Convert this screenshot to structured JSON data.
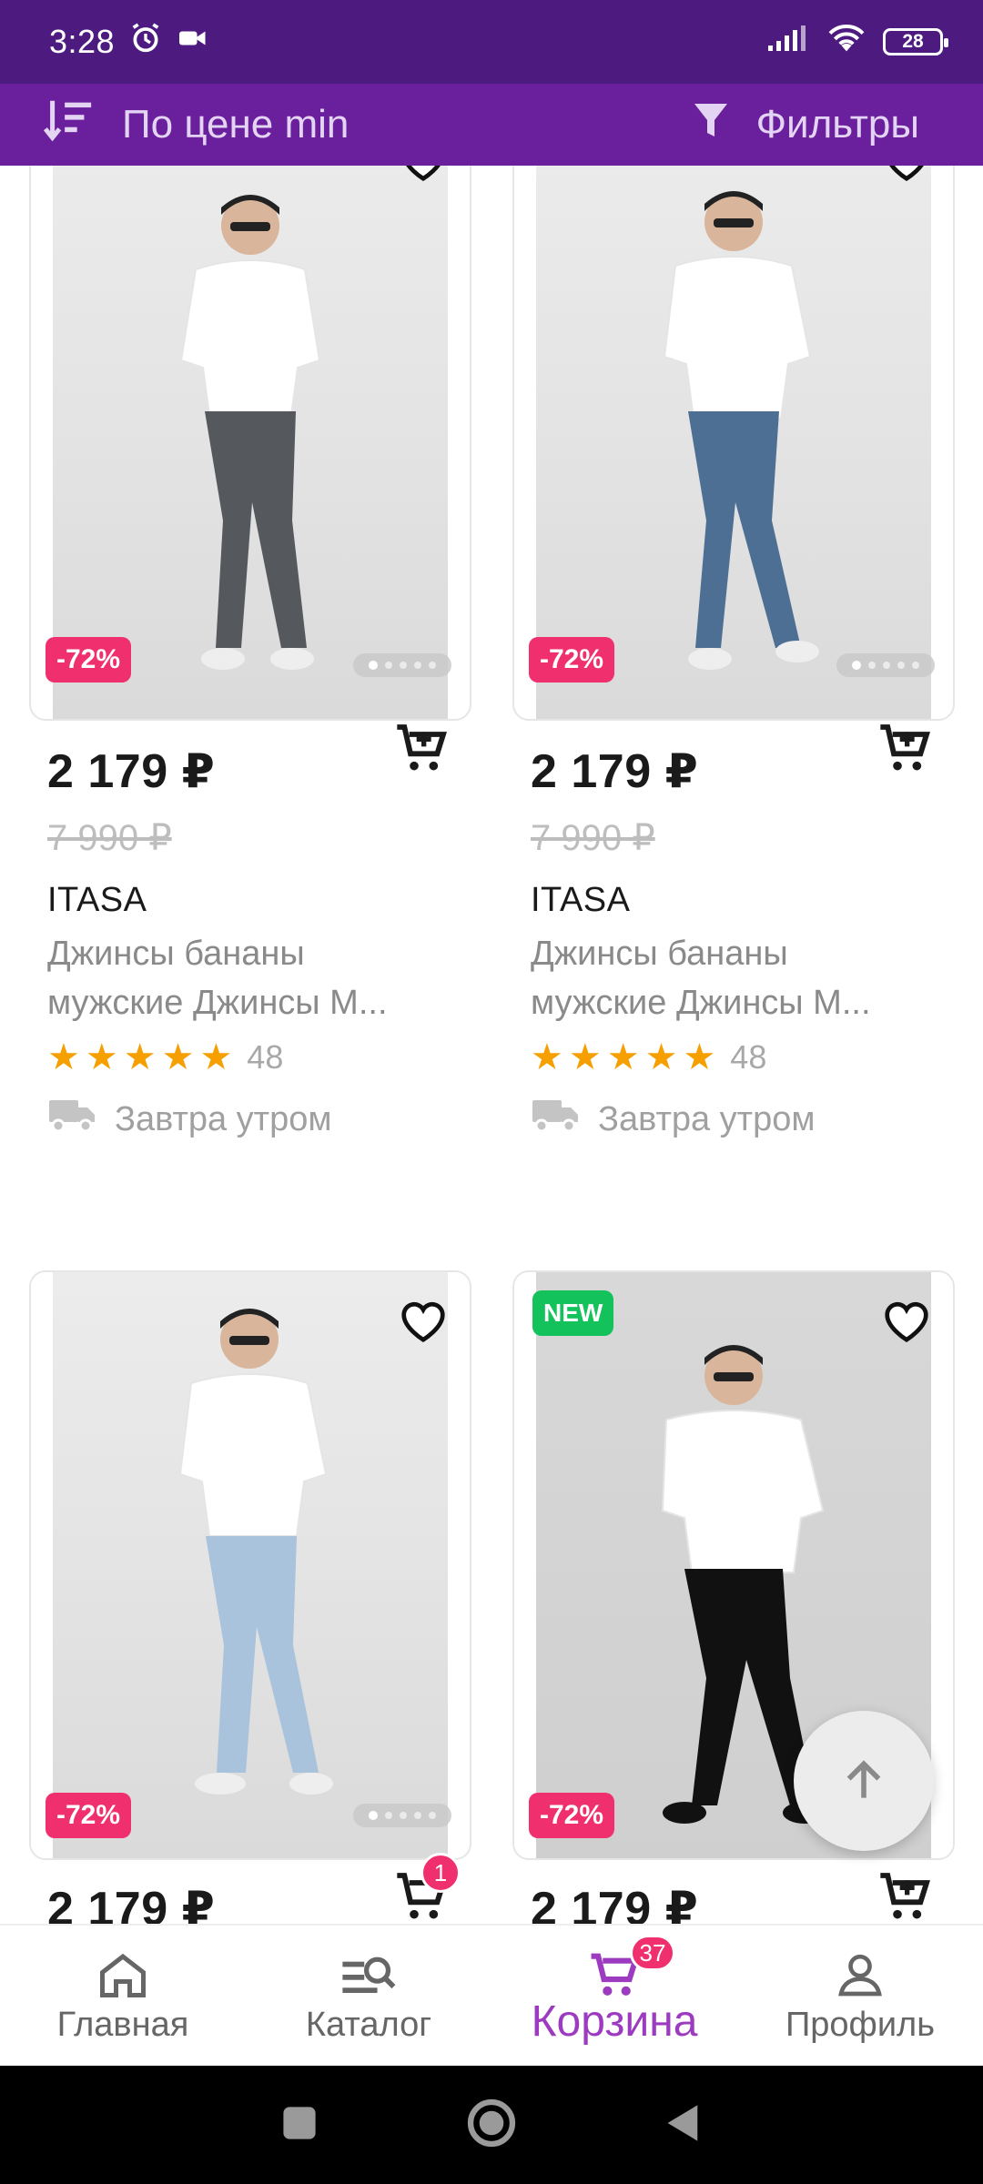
{
  "status_bar": {
    "time": "3:28",
    "battery": "28"
  },
  "toolbar": {
    "sort_label": "По цене min",
    "filter_label": "Фильтры"
  },
  "products": [
    {
      "price": "2 179 ₽",
      "old_price": "7 990 ₽",
      "brand": "ITASA",
      "title": "Джинсы бананы мужские Джинсы М...",
      "rating_count": "48",
      "delivery": "Завтра утром",
      "discount": "-72%",
      "jeans_color": "#55585c"
    },
    {
      "price": "2 179 ₽",
      "old_price": "7 990 ₽",
      "brand": "ITASA",
      "title": "Джинсы бананы мужские Джинсы М...",
      "rating_count": "48",
      "delivery": "Завтра утром",
      "discount": "-72%",
      "jeans_color": "#4d6f94"
    },
    {
      "price": "2 179 ₽",
      "discount": "-72%",
      "cart_count": "1",
      "jeans_color": "#a9c3dc"
    },
    {
      "price": "2 179 ₽",
      "discount": "-72%",
      "badge_new": "NEW",
      "jeans_color": "#111111"
    }
  ],
  "bottom_nav": [
    {
      "label": "Главная",
      "icon": "home-icon"
    },
    {
      "label": "Каталог",
      "icon": "catalog-search-icon"
    },
    {
      "label": "Корзина",
      "icon": "cart-icon",
      "badge": "37",
      "active": true
    },
    {
      "label": "Профиль",
      "icon": "profile-icon"
    }
  ],
  "colors": {
    "status_bar": "#4d1a80",
    "toolbar": "#6a1f9c",
    "accent": "#9c3bc0",
    "discount": "#f0306e",
    "new_badge": "#13c25a",
    "star": "#f5a000"
  }
}
